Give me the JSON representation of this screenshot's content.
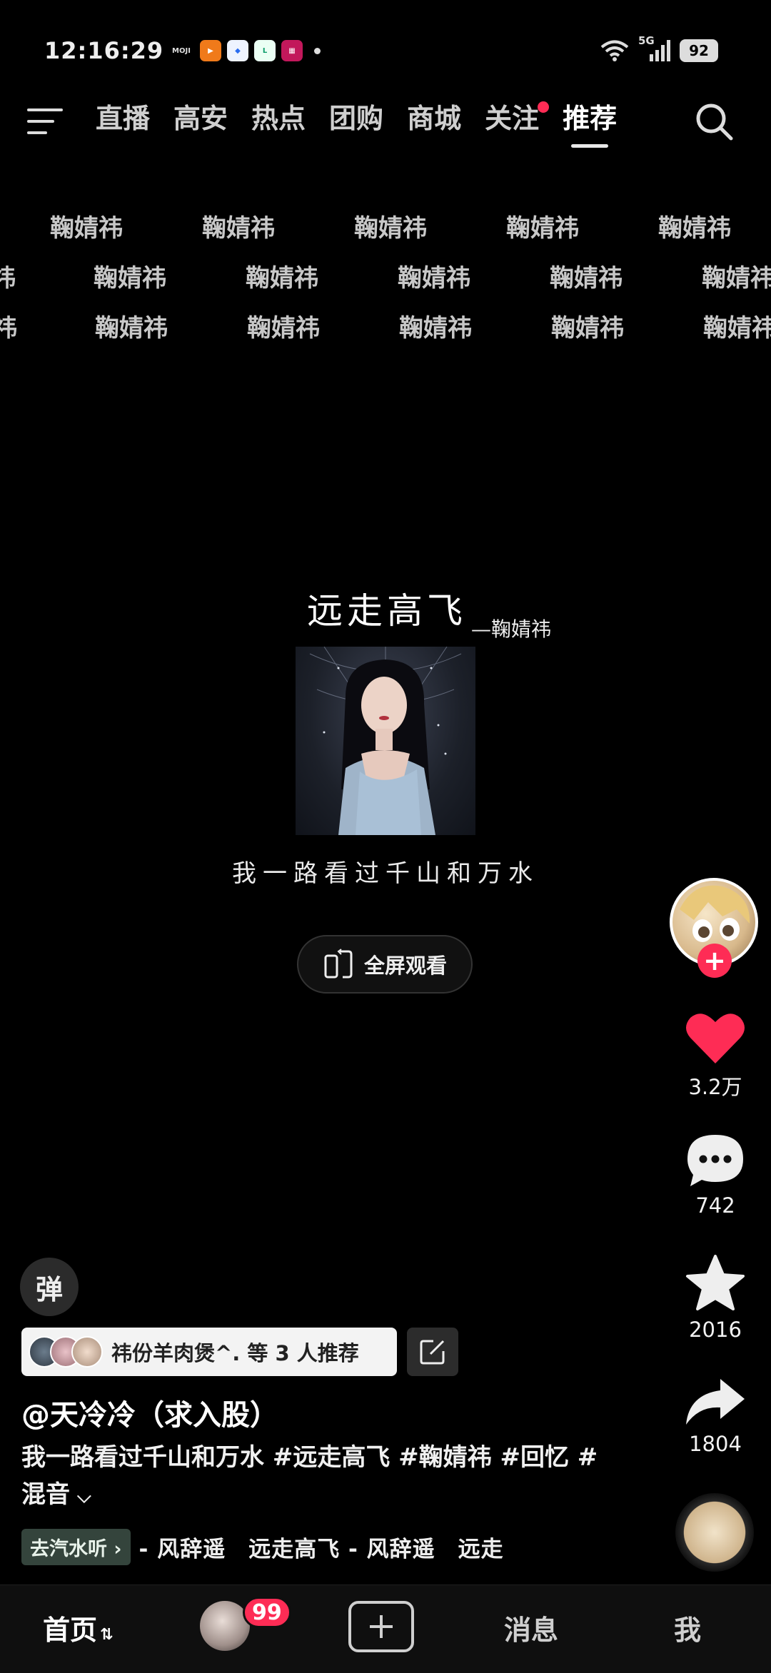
{
  "status_bar": {
    "time": "12:16:29",
    "network": "5G",
    "battery": "92"
  },
  "top_nav": {
    "tabs": [
      {
        "label": "直播"
      },
      {
        "label": "高安"
      },
      {
        "label": "热点"
      },
      {
        "label": "团购"
      },
      {
        "label": "商城"
      },
      {
        "label": "关注"
      },
      {
        "label": "推荐"
      }
    ],
    "active_tab": "推荐"
  },
  "watermark": {
    "text": "鞠婧祎"
  },
  "video": {
    "song_title": "远走高飞",
    "song_artist": "—鞠婧祎",
    "lyric": "我一路看过千山和万水",
    "fullscreen_label": "全屏观看"
  },
  "actions": {
    "likes": "3.2万",
    "comments": "742",
    "favorites": "2016",
    "shares": "1804"
  },
  "info": {
    "danmu_label": "弹",
    "recommend_text": "祎份羊肉煲^. 等 3 人推荐",
    "author": "@天冷冷（求入股）",
    "description": "我一路看过千山和万水 #远走高飞 #鞠婧祎 #回忆 #混音",
    "qishui_label": "去汽水听",
    "music_text": "- 风辞遥　远走高飞 - 风辞遥　远走"
  },
  "bottom_nav": {
    "home": "首页",
    "messages": "消息",
    "me": "我",
    "badge_count": "99"
  },
  "colors": {
    "accent": "#fe2c55",
    "background": "#000000"
  }
}
